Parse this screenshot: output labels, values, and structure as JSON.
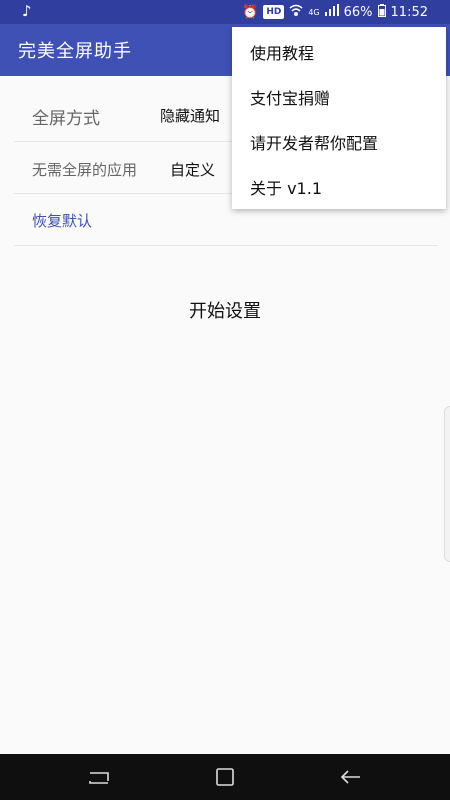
{
  "status_bar": {
    "music_icon": "music-note-icon",
    "alarm_icon": "alarm-icon",
    "hd": "HD",
    "wifi_icon": "wifi-icon",
    "network": "4G",
    "signal_icon": "signal-icon",
    "battery_percent": "66%",
    "battery_icon": "battery-icon",
    "time": "11:52"
  },
  "app_bar": {
    "title": "完美全屏助手"
  },
  "settings": {
    "fullscreen_mode": {
      "label": "全屏方式",
      "value": "隐藏通知"
    },
    "excluded_apps": {
      "label": "无需全屏的应用",
      "value": "自定义"
    },
    "restore_default": "恢复默认"
  },
  "start_button": "开始设置",
  "menu": {
    "items": [
      "使用教程",
      "支付宝捐赠",
      "请开发者帮你配置",
      "关于 v1.1"
    ]
  },
  "nav_bar": {
    "recent": "recent-apps-icon",
    "home": "home-icon",
    "back": "back-icon"
  },
  "colors": {
    "app_bar": "#3f51b5",
    "status_bar": "#303f9f",
    "accent_link": "#3f51b5"
  }
}
